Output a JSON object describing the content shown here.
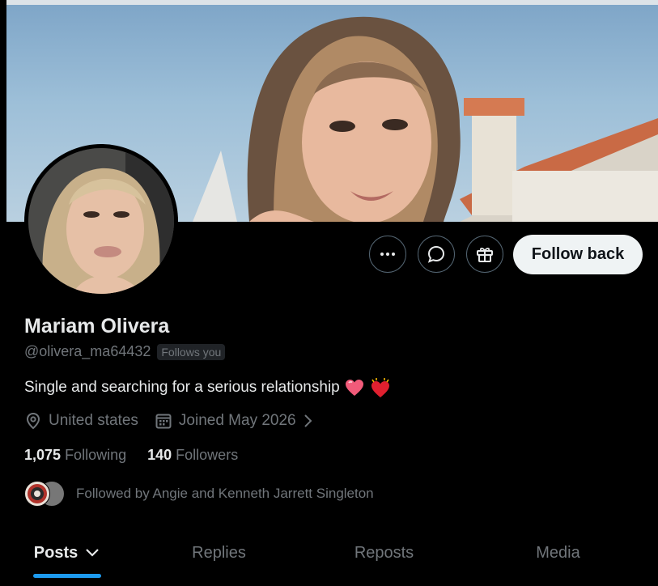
{
  "profile": {
    "name": "Mariam Olivera",
    "handle": "@olivera_ma64432",
    "follows_you": "Follows you",
    "bio": "Single and searching for a serious relationship",
    "location": "United states",
    "joined": "Joined May 2026",
    "following_count": "1,075",
    "following_label": "Following",
    "followers_count": "140",
    "followers_label": "Followers",
    "followed_by": "Followed by Angie and Kenneth Jarrett Singleton"
  },
  "actions": {
    "more_icon": "more-icon",
    "message_icon": "message-icon",
    "gift_icon": "gift-icon",
    "follow_label": "Follow back"
  },
  "tabs": [
    {
      "label": "Posts",
      "active": true
    },
    {
      "label": "Replies",
      "active": false
    },
    {
      "label": "Reposts",
      "active": false
    },
    {
      "label": "Media",
      "active": false
    }
  ],
  "colors": {
    "accent": "#1d9bf0",
    "background": "#000000",
    "muted_text": "#71767b"
  }
}
